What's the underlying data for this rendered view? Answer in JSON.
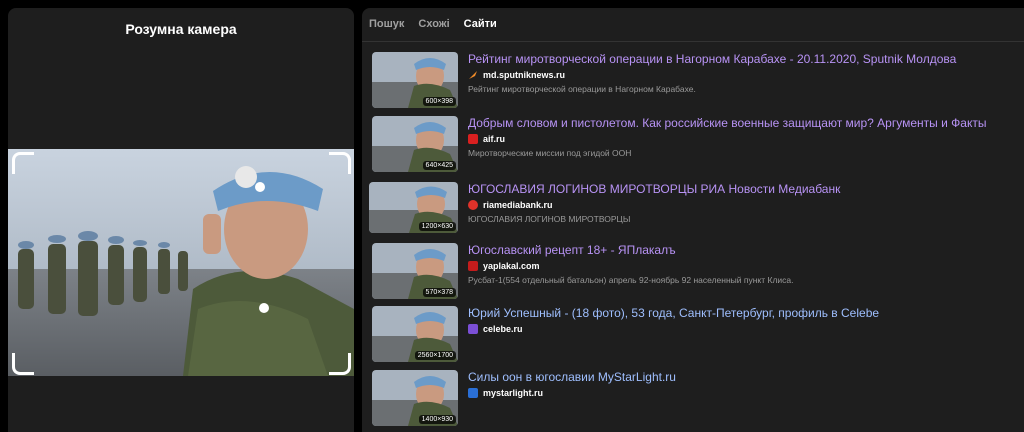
{
  "left": {
    "title": "Розумна камера"
  },
  "tabs": [
    {
      "label": "Пошук",
      "active": false
    },
    {
      "label": "Схожі",
      "active": false
    },
    {
      "label": "Сайти",
      "active": true
    }
  ],
  "results": [
    {
      "title": "Рейтинг миротворческой операции в Нагорном Карабахе - 20.11.2020, Sputnik Молдова",
      "site": "md.sputniknews.ru",
      "favicon": "sputnik-icon",
      "description": "Рейтинг миротворческой операции в Нагорном Карабахе.",
      "size": "600×398"
    },
    {
      "title": "Добрым словом и пистолетом. Как российские военные защищают мир? Аргументы и Факты",
      "site": "aif.ru",
      "favicon": "aif-icon",
      "description": "Миротворческие миссии под эгидой ООН",
      "size": "640×425"
    },
    {
      "title": "ЮГОСЛАВИЯ ЛОГИНОВ МИРОТВОРЦЫ РИА Новости Медиабанк",
      "site": "riamediabank.ru",
      "favicon": "ria-icon",
      "description": "ЮГОСЛАВИЯ ЛОГИНОВ МИРОТВОРЦЫ",
      "size": "1200×630"
    },
    {
      "title": "Югославский рецепт 18+ - ЯПлакалъ",
      "site": "yaplakal.com",
      "favicon": "yaplakal-icon",
      "description": "Русбат-1(554 отдельный батальон) апрель 92-ноябрь 92 населенный пункт Клиса.",
      "size": "570×378"
    },
    {
      "title": "Юрий Успешный - (18 фото), 53 года, Санкт-Петербург, профиль в Celebe",
      "site": "celebe.ru",
      "favicon": "celebe-icon",
      "description": "",
      "size": "2560×1700"
    },
    {
      "title": "Силы оон в югославии MyStarLight.ru",
      "site": "mystarlight.ru",
      "favicon": "mystarlight-icon",
      "description": "",
      "size": "1400×930"
    }
  ],
  "colors": {
    "background": "#000000",
    "panel": "#1e1e1e",
    "link_visited": "#b893f5",
    "link": "#9fbfff",
    "muted": "#9a9a9a"
  }
}
